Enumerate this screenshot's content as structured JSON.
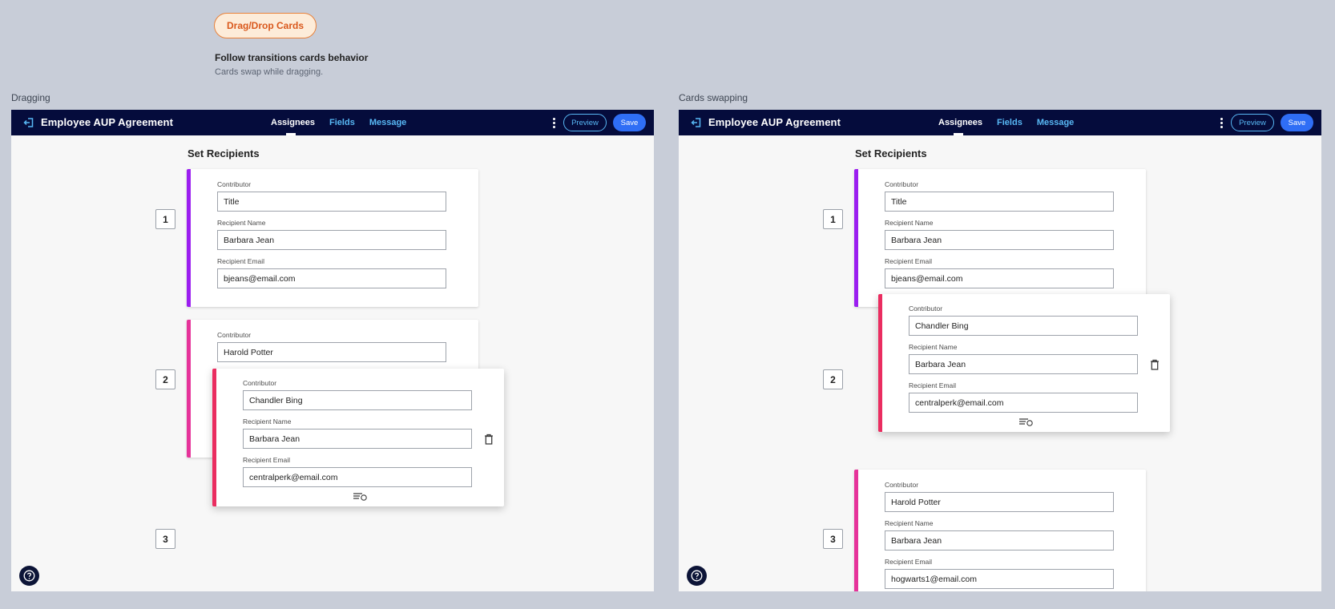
{
  "header": {
    "pill_label": "Drag/Drop Cards",
    "title": "Follow transitions cards behavior",
    "subtitle": "Cards swap while dragging."
  },
  "panels": [
    {
      "label": "Dragging",
      "app_title": "Employee AUP Agreement",
      "tabs": [
        "Assignees",
        "Fields",
        "Message"
      ],
      "preview_label": "Preview",
      "save_label": "Save",
      "section_title": "Set Recipients",
      "numbers": [
        "1",
        "2",
        "3"
      ],
      "cards": [
        {
          "contributor_label": "Contributor",
          "contributor": "Title",
          "name_label": "Recipient Name",
          "name": "Barbara Jean",
          "email_label": "Recipient Email",
          "email": "bjeans@email.com"
        },
        {
          "contributor_label": "Contributor",
          "contributor": "Harold Potter"
        },
        {
          "contributor_label": "Contributor",
          "contributor": "Chandler Bing",
          "name_label": "Recipient Name",
          "name": "Barbara Jean",
          "email_label": "Recipient Email",
          "email": "centralperk@email.com"
        }
      ]
    },
    {
      "label": "Cards swapping",
      "app_title": "Employee AUP Agreement",
      "tabs": [
        "Assignees",
        "Fields",
        "Message"
      ],
      "preview_label": "Preview",
      "save_label": "Save",
      "section_title": "Set Recipients",
      "numbers": [
        "1",
        "2",
        "3"
      ],
      "cards": [
        {
          "contributor_label": "Contributor",
          "contributor": "Title",
          "name_label": "Recipient Name",
          "name": "Barbara Jean",
          "email_label": "Recipient Email",
          "email": "bjeans@email.com"
        },
        {
          "contributor_label": "Contributor",
          "contributor": "Chandler Bing",
          "name_label": "Recipient Name",
          "name": "Barbara Jean",
          "email_label": "Recipient Email",
          "email": "centralperk@email.com"
        },
        {
          "contributor_label": "Contributor",
          "contributor": "Harold Potter",
          "name_label": "Recipient Name",
          "name": "Barbara Jean",
          "email_label": "Recipient Email",
          "email": "hogwarts1@email.com"
        }
      ]
    }
  ],
  "colors": {
    "appbar": "#050c3c",
    "accent_purple": "#9b1ef0",
    "accent_pink": "#e6339a",
    "accent_red": "#ea2d60",
    "tab_link": "#58b8f5",
    "save": "#2f6ef5",
    "pill_text": "#d9581c"
  },
  "icons": [
    "back-arrow-icon",
    "kebab-menu-icon",
    "trash-icon",
    "drag-handle-icon",
    "help-icon"
  ]
}
